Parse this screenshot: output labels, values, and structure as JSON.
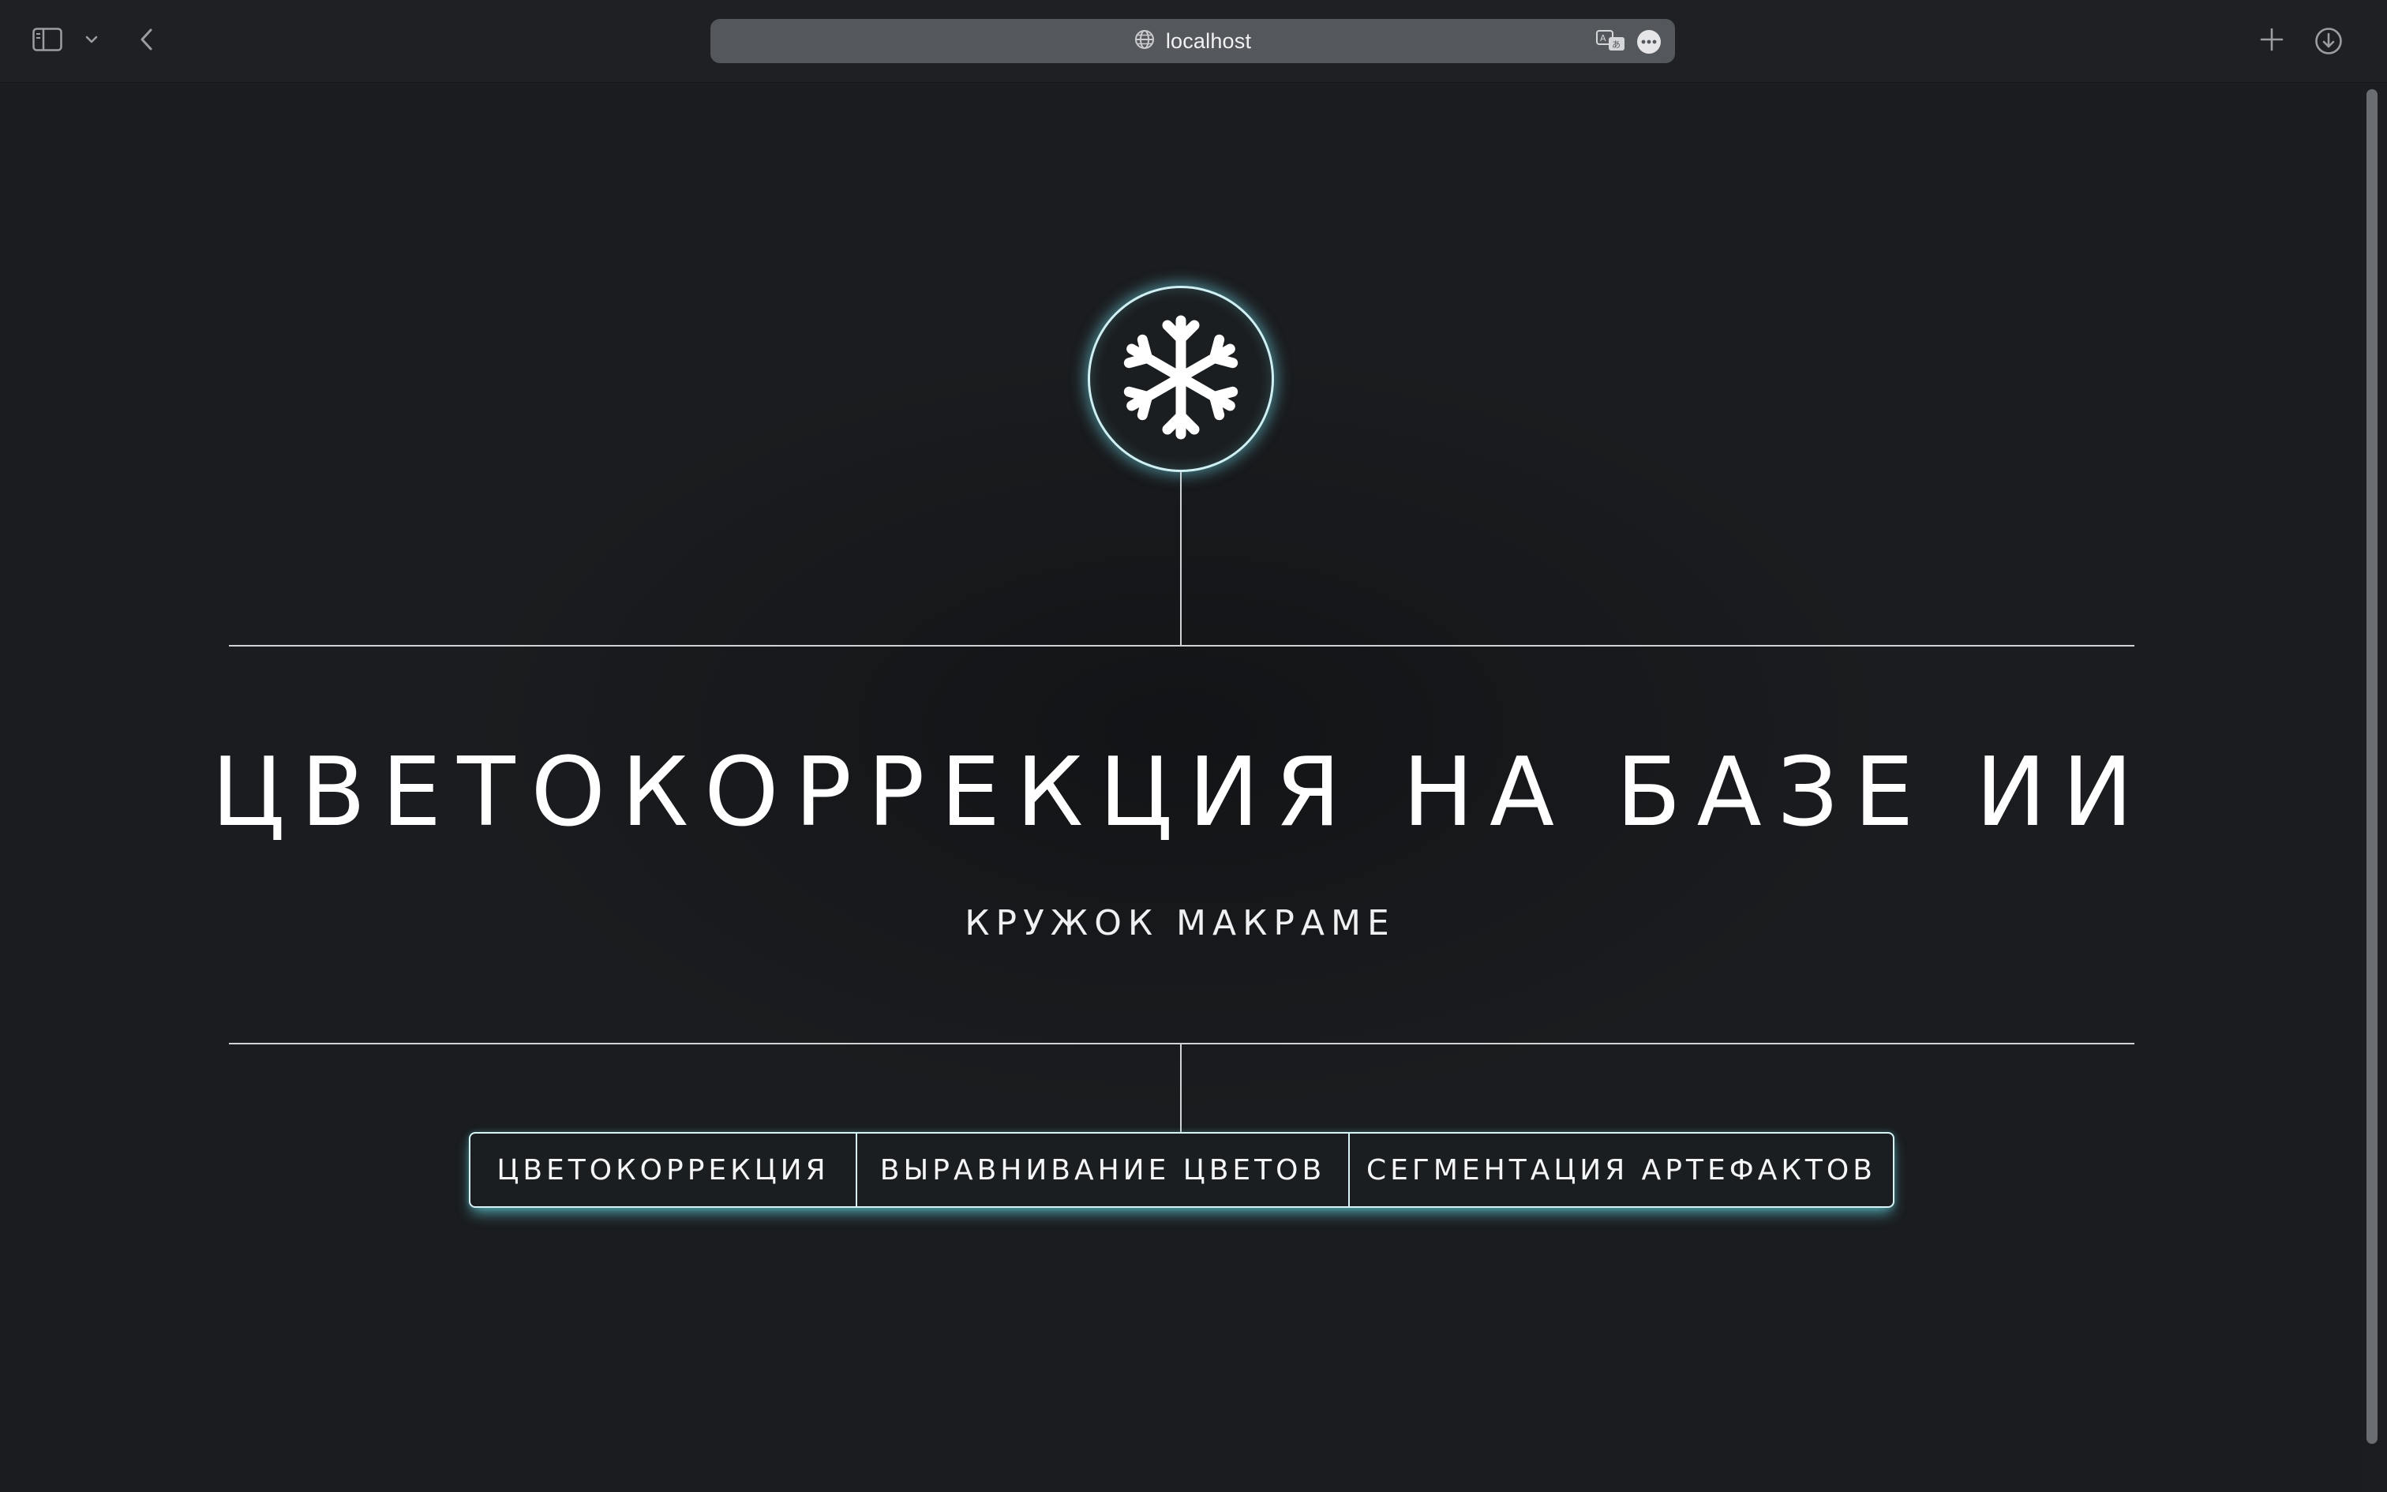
{
  "browser": {
    "url": "localhost",
    "icons": {
      "sidebar": "sidebar-icon",
      "chevron": "chevron-down-icon",
      "back": "chevron-left-icon",
      "site": "globe-icon",
      "translate": "translate-icon",
      "more": "ellipsis-icon",
      "new_tab": "plus-icon",
      "downloads": "download-icon"
    }
  },
  "hero": {
    "logo_icon": "snowflake-icon",
    "title": "ЦВЕТОКОРРЕКЦИЯ НА БАЗЕ ИИ",
    "subtitle": "КРУЖОК МАКРАМЕ",
    "accent_color": "#6ed2e1"
  },
  "nav": {
    "tabs": [
      {
        "label": "ЦВЕТОКОРРЕКЦИЯ"
      },
      {
        "label": "ВЫРАВНИВАНИЕ ЦВЕТОВ"
      },
      {
        "label": "СЕГМЕНТАЦИЯ АРТЕФАКТОВ"
      }
    ]
  }
}
